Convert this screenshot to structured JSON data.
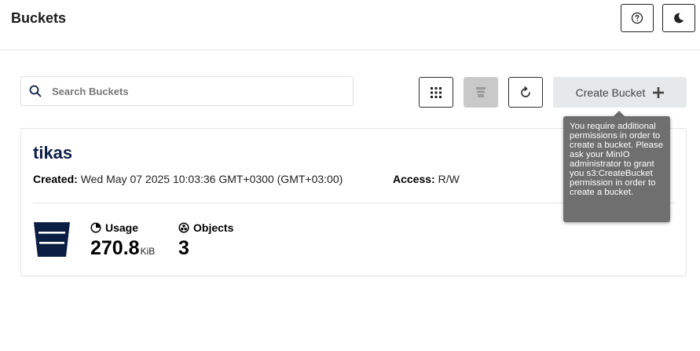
{
  "header": {
    "title": "Buckets",
    "help_icon": "help-circle-icon",
    "theme_icon": "moon-icon"
  },
  "toolbar": {
    "search_placeholder": "Search Buckets",
    "search_value": "",
    "view_toggle_icon": "grid-icon",
    "bulk_icon": "stack-icon",
    "refresh_icon": "refresh-icon",
    "create_label": "Create Bucket",
    "create_icon": "plus-icon",
    "create_disabled": true
  },
  "tooltip": {
    "text": "You require additional permissions in order to create a bucket. Please ask your MinIO administrator to grant you s3:CreateBucket permission in order to create a bucket."
  },
  "buckets": [
    {
      "name": "tikas",
      "created_label": "Created:",
      "created_value": "Wed May 07 2025 10:03:36 GMT+0300 (GMT+03:00)",
      "access_label": "Access:",
      "access_value": "R/W",
      "usage_label": "Usage",
      "usage_value": "270.8",
      "usage_unit": "KiB",
      "objects_label": "Objects",
      "objects_value": "3"
    }
  ],
  "colors": {
    "brand_navy": "#0c1d44",
    "tooltip_bg": "#6f6f6f",
    "disabled_bg": "#e6e8ea"
  }
}
